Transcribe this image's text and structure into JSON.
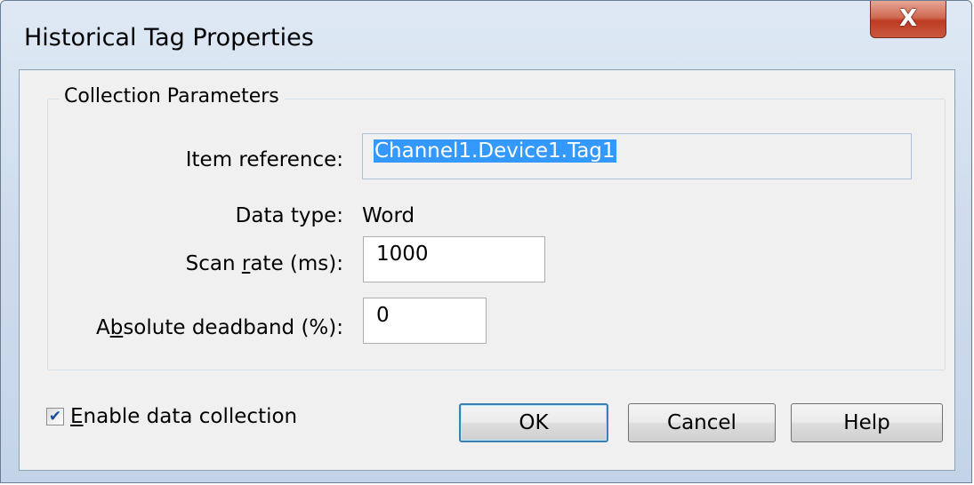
{
  "window": {
    "title": "Historical Tag Properties",
    "close_glyph": "X"
  },
  "group": {
    "label": "Collection Parameters"
  },
  "fields": {
    "item_reference": {
      "label": "Item reference:",
      "value": "Channel1.Device1.Tag1"
    },
    "data_type": {
      "label": "Data type:",
      "value": "Word"
    },
    "scan_rate": {
      "label_pre": "Scan ",
      "label_accel": "r",
      "label_post": "ate (ms):",
      "value": "1000"
    },
    "deadband": {
      "label_pre": "A",
      "label_accel": "b",
      "label_post": "solute deadband (%):",
      "value": "0"
    }
  },
  "enable_collection": {
    "label_accel": "E",
    "label_post": "nable data collection",
    "checked": true
  },
  "buttons": {
    "ok": "OK",
    "cancel": "Cancel",
    "help": "Help"
  },
  "colors": {
    "selection": "#3399ff",
    "default_button_border": "#3c7fb1",
    "close_button": "#c75a3e"
  }
}
